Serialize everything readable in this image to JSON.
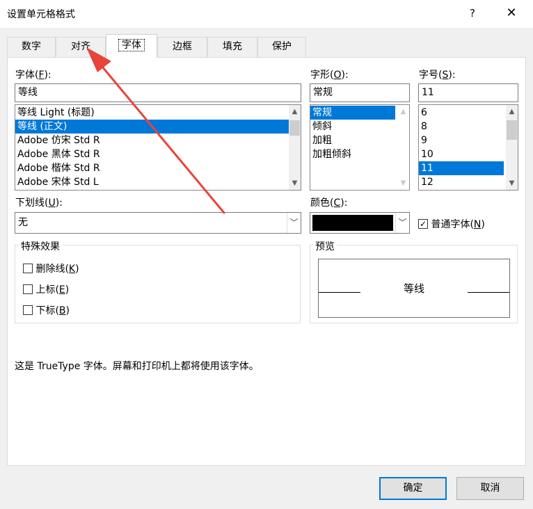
{
  "window": {
    "title": "设置单元格格式",
    "help": "?",
    "close": "✕"
  },
  "tabs": [
    {
      "label": "数字"
    },
    {
      "label": "对齐"
    },
    {
      "label": "字体"
    },
    {
      "label": "边框"
    },
    {
      "label": "填充"
    },
    {
      "label": "保护"
    }
  ],
  "font": {
    "label": "字体",
    "accesskey": "F",
    "value": "等线",
    "items": [
      "等线 Light (标题)",
      "等线 (正文)",
      "Adobe 仿宋 Std R",
      "Adobe 黑体 Std R",
      "Adobe 楷体 Std R",
      "Adobe 宋体 Std L"
    ],
    "selected_index": 1
  },
  "style": {
    "label": "字形",
    "accesskey": "O",
    "value": "常规",
    "items": [
      "常规",
      "倾斜",
      "加粗",
      "加粗倾斜"
    ],
    "selected_index": 0
  },
  "size": {
    "label": "字号",
    "accesskey": "S",
    "value": "11",
    "items": [
      "6",
      "8",
      "9",
      "10",
      "11",
      "12"
    ],
    "selected_index": 4
  },
  "underline": {
    "label": "下划线",
    "accesskey": "U",
    "value": "无"
  },
  "color": {
    "label": "颜色",
    "accesskey": "C",
    "swatch": "#000000"
  },
  "normal_font": {
    "label": "普通字体",
    "accesskey": "N",
    "checked": true
  },
  "effects": {
    "label": "特殊效果",
    "items": [
      {
        "label": "删除线",
        "accesskey": "K"
      },
      {
        "label": "上标",
        "accesskey": "E"
      },
      {
        "label": "下标",
        "accesskey": "B"
      }
    ]
  },
  "preview": {
    "label": "预览",
    "sample": "等线"
  },
  "info_text": "这是 TrueType 字体。屏幕和打印机上都将使用该字体。",
  "buttons": {
    "ok": "确定",
    "cancel": "取消"
  },
  "accent_color": "#0078d7",
  "annotation_arrow_color": "#e8443a"
}
